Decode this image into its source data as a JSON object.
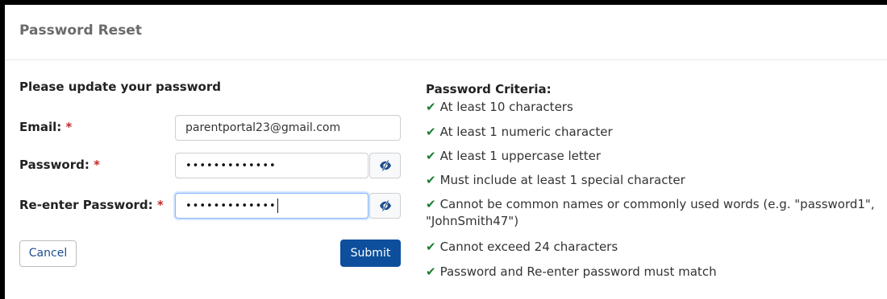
{
  "header": {
    "title": "Password Reset"
  },
  "form": {
    "heading": "Please update your password",
    "required_mark": "*",
    "email": {
      "label": "Email:",
      "value": "parentportal23@gmail.com"
    },
    "password": {
      "label": "Password:",
      "masked_value": "•••••••••••••"
    },
    "reenter": {
      "label": "Re-enter Password:",
      "masked_value": "•••••••••••••"
    },
    "eye_icon": "eye-slash-icon",
    "cancel_label": "Cancel",
    "submit_label": "Submit"
  },
  "criteria": {
    "title": "Password Criteria:",
    "check_glyph": "✔",
    "items": [
      "At least 10 characters",
      "At least 1 numeric character",
      "At least 1 uppercase letter",
      "Must include at least 1 special character",
      "Cannot be common names or commonly used words (e.g. \"password1\", \"JohnSmith47\")",
      "Cannot exceed 24 characters",
      "Password and Re-enter password must match"
    ]
  },
  "colors": {
    "accent": "#0d4f9c",
    "check": "#1e7e34",
    "required": "#c62828",
    "eye_icon": "#1f4e8c"
  }
}
